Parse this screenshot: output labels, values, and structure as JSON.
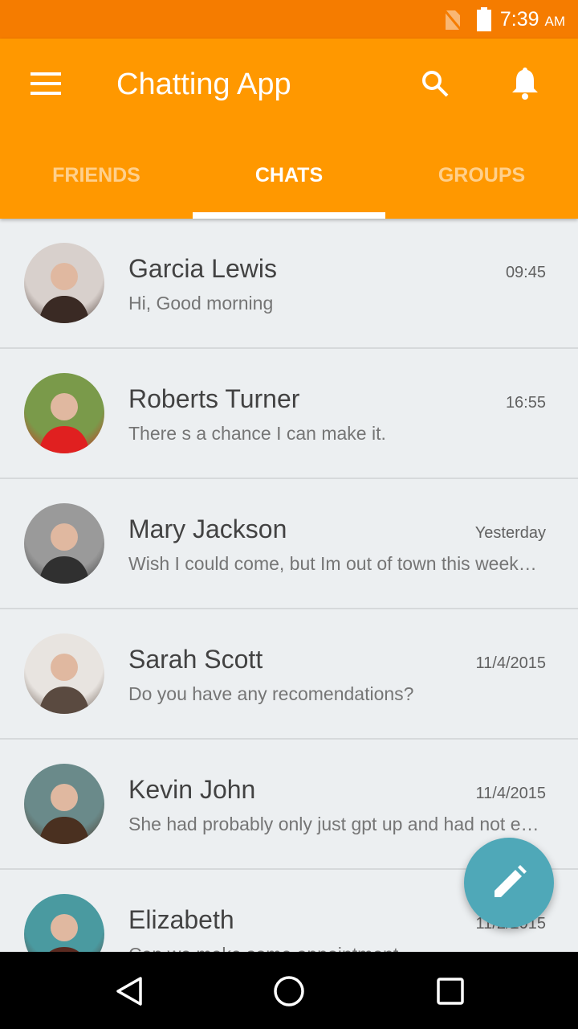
{
  "status": {
    "time": "7:39",
    "ampm": "AM"
  },
  "appbar": {
    "title": "Chatting App",
    "menu_icon": "hamburger-icon",
    "search_icon": "search-icon",
    "notif_icon": "bell-icon"
  },
  "tabs": [
    {
      "label": "FRIENDS"
    },
    {
      "label": "CHATS",
      "active": true
    },
    {
      "label": "GROUPS"
    }
  ],
  "chats": [
    {
      "name": "Garcia Lewis",
      "time": "09:45",
      "message": "Hi, Good morning",
      "avatar": [
        "#d8d0cc",
        "#3a2a24"
      ]
    },
    {
      "name": "Roberts Turner",
      "time": "16:55",
      "message": "There s a chance I can make it.",
      "avatar": [
        "#7a9a4a",
        "#e02020"
      ]
    },
    {
      "name": "Mary Jackson",
      "time": "Yesterday",
      "message": "Wish I could come, but Im out of town this weekend",
      "avatar": [
        "#9a9a9a",
        "#303030"
      ]
    },
    {
      "name": "Sarah Scott",
      "time": "11/4/2015",
      "message": "Do you have any recomendations?",
      "avatar": [
        "#e8e4e0",
        "#5a4a40"
      ]
    },
    {
      "name": "Kevin John",
      "time": "11/4/2015",
      "message": "She had probably only just gpt up and had not eaten",
      "avatar": [
        "#6a8a8a",
        "#4a3020"
      ]
    },
    {
      "name": "Elizabeth",
      "time": "11/2/2015",
      "message": "Can we make some appointment",
      "avatar": [
        "#4a9aa0",
        "#5a2a20"
      ]
    }
  ],
  "fab": {
    "icon": "pencil-icon"
  },
  "colors": {
    "primary": "#ff9800",
    "status": "#f57c00",
    "fab": "#4fa8b8"
  }
}
